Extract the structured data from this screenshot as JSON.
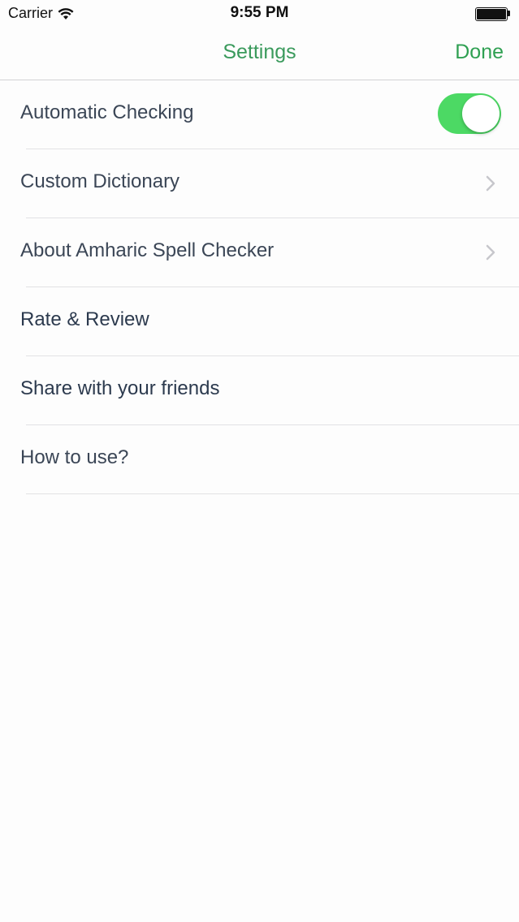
{
  "status_bar": {
    "carrier": "Carrier",
    "time": "9:55 PM",
    "icons": [
      "wifi-icon",
      "battery-icon"
    ]
  },
  "nav": {
    "title": "Settings",
    "done_label": "Done"
  },
  "settings": {
    "items": [
      {
        "label": "Automatic Checking",
        "control": "toggle",
        "toggle_on": true
      },
      {
        "label": "Custom Dictionary",
        "control": "chevron"
      },
      {
        "label": "About Amharic Spell Checker",
        "control": "chevron"
      },
      {
        "label": "Rate & Review",
        "control": "none"
      },
      {
        "label": "Share with your friends",
        "control": "none"
      },
      {
        "label": "How to use?",
        "control": "none"
      }
    ]
  },
  "colors": {
    "accent": "#2fa052",
    "toggle_on": "#4cd964",
    "background": "#fdfdfd",
    "chevron": "#c7c7cc"
  }
}
